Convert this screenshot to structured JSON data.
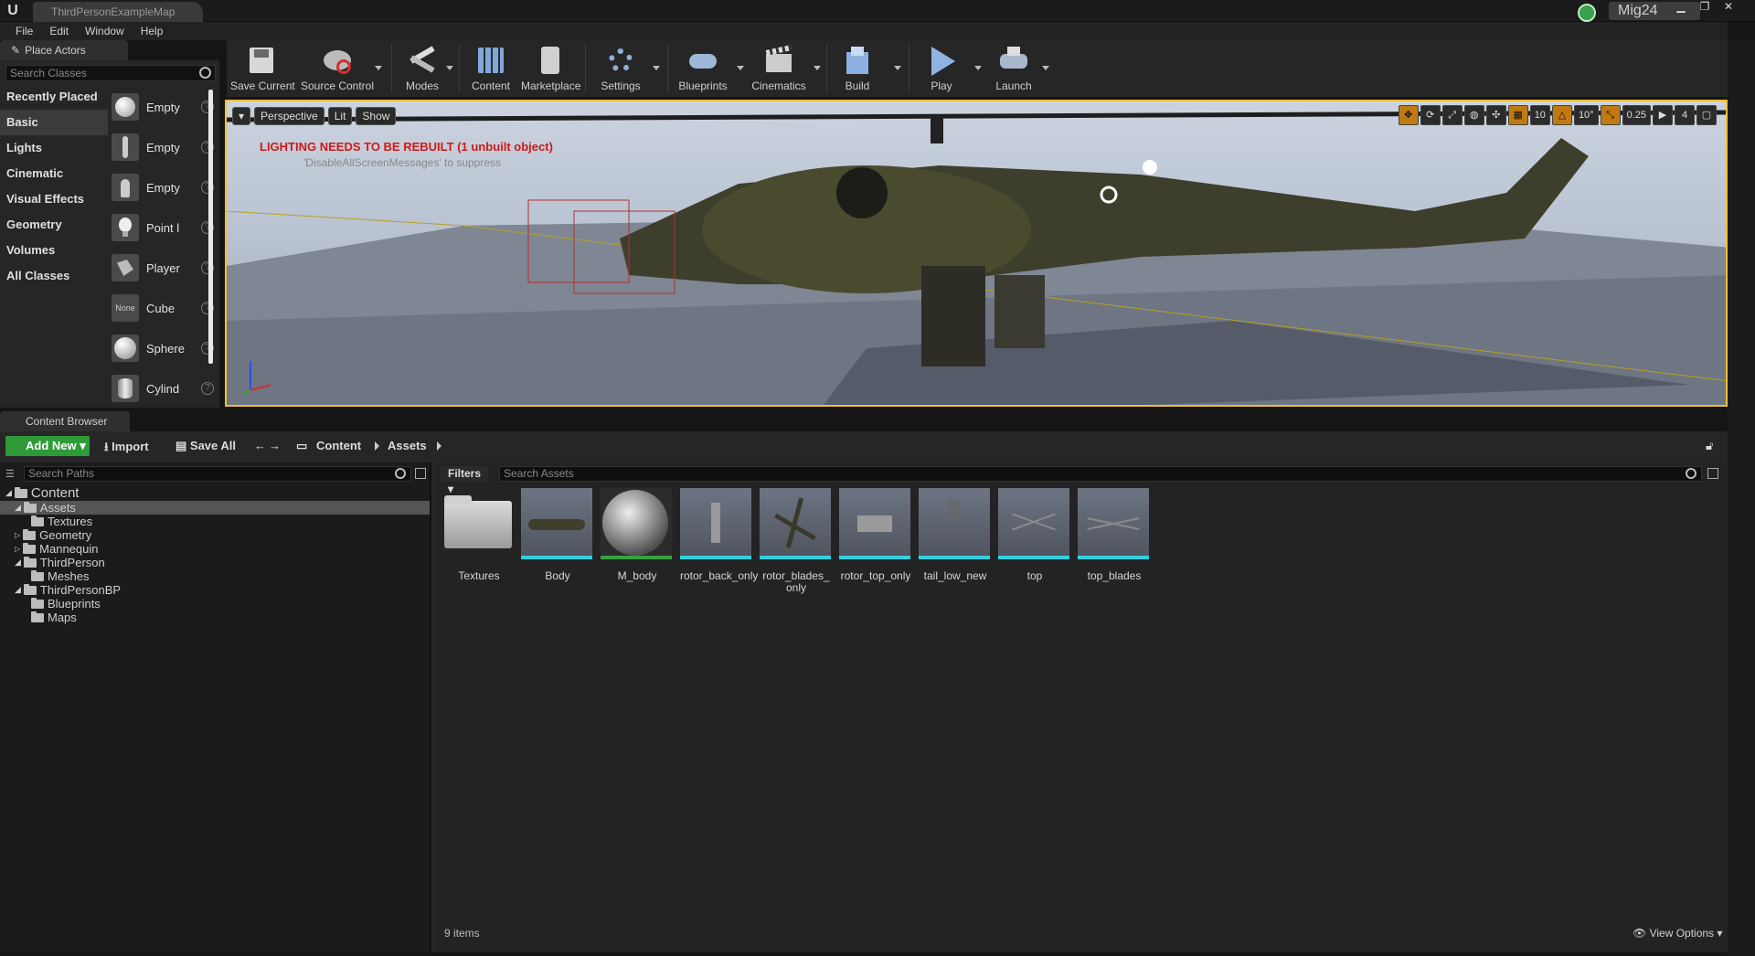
{
  "window": {
    "map_tab": "ThirdPersonExampleMap",
    "project_name": "Mig24"
  },
  "menu": [
    "File",
    "Edit",
    "Window",
    "Help"
  ],
  "place_actors": {
    "tab_label": "Place Actors",
    "search_placeholder": "Search Classes",
    "categories": [
      "Recently Placed",
      "Basic",
      "Lights",
      "Cinematic",
      "Visual Effects",
      "Geometry",
      "Volumes",
      "All Classes"
    ],
    "active_category": "Basic",
    "items": [
      {
        "label": "Empty",
        "icon": "sphere-icon"
      },
      {
        "label": "Empty",
        "icon": "character-icon"
      },
      {
        "label": "Empty",
        "icon": "pawn-icon"
      },
      {
        "label": "Point l",
        "icon": "point-light-icon"
      },
      {
        "label": "Player",
        "icon": "player-start-icon"
      },
      {
        "label": "Cube",
        "icon": "cube-icon",
        "thumb_text": "None"
      },
      {
        "label": "Sphere",
        "icon": "sphere-icon"
      },
      {
        "label": "Cylind",
        "icon": "cylinder-icon"
      }
    ]
  },
  "toolbar": [
    {
      "label": "Save Current",
      "icon": "save-icon"
    },
    {
      "label": "Source Control",
      "icon": "source-control-icon"
    },
    {
      "label": "Modes",
      "icon": "modes-icon"
    },
    {
      "label": "Content",
      "icon": "content-icon"
    },
    {
      "label": "Marketplace",
      "icon": "marketplace-icon"
    },
    {
      "label": "Settings",
      "icon": "settings-icon"
    },
    {
      "label": "Blueprints",
      "icon": "blueprints-icon"
    },
    {
      "label": "Cinematics",
      "icon": "cinematics-icon"
    },
    {
      "label": "Build",
      "icon": "build-icon"
    },
    {
      "label": "Play",
      "icon": "play-icon"
    },
    {
      "label": "Launch",
      "icon": "launch-icon"
    }
  ],
  "viewport": {
    "perspective_label": "Perspective",
    "lit_label": "Lit",
    "show_label": "Show",
    "warning": "LIGHTING NEEDS TO BE REBUILT (1 unbuilt object)",
    "suppress": "'DisableAllScreenMessages' to suppress",
    "grid_snap": "10",
    "rotation_snap": "10°",
    "scale_snap": "0.25",
    "camera_speed": "4"
  },
  "content_browser": {
    "tab_label": "Content Browser",
    "add_new": "Add New",
    "import": "Import",
    "save_all": "Save All",
    "breadcrumb": [
      "Content",
      "Assets"
    ],
    "search_paths_placeholder": "Search Paths",
    "filters": "Filters",
    "search_assets_placeholder": "Search Assets",
    "tree": [
      {
        "label": "Content",
        "depth": 0,
        "expanded": true
      },
      {
        "label": "Assets",
        "depth": 1,
        "expanded": true,
        "selected": true
      },
      {
        "label": "Textures",
        "depth": 2
      },
      {
        "label": "Geometry",
        "depth": 1,
        "expanded": false
      },
      {
        "label": "Mannequin",
        "depth": 1,
        "expanded": false
      },
      {
        "label": "ThirdPerson",
        "depth": 1,
        "expanded": true
      },
      {
        "label": "Meshes",
        "depth": 2
      },
      {
        "label": "ThirdPersonBP",
        "depth": 1,
        "expanded": true
      },
      {
        "label": "Blueprints",
        "depth": 2
      },
      {
        "label": "Maps",
        "depth": 2
      }
    ],
    "assets": [
      {
        "label": "Textures",
        "kind": "folder"
      },
      {
        "label": "Body",
        "kind": "mesh"
      },
      {
        "label": "M_body",
        "kind": "material"
      },
      {
        "label": "rotor_back_only",
        "kind": "mesh"
      },
      {
        "label": "rotor_blades_ only",
        "kind": "mesh"
      },
      {
        "label": "rotor_top_only",
        "kind": "mesh"
      },
      {
        "label": "tail_low_new",
        "kind": "mesh"
      },
      {
        "label": "top",
        "kind": "mesh"
      },
      {
        "label": "top_blades",
        "kind": "mesh"
      }
    ],
    "item_count": "9 items",
    "view_options": "View Options"
  },
  "colors": {
    "accent_green": "#2e9a38",
    "viewport_border": "#f0c030",
    "warning_red": "#d01818",
    "mesh_underline": "#33d0e0",
    "material_underline": "#38a040"
  }
}
